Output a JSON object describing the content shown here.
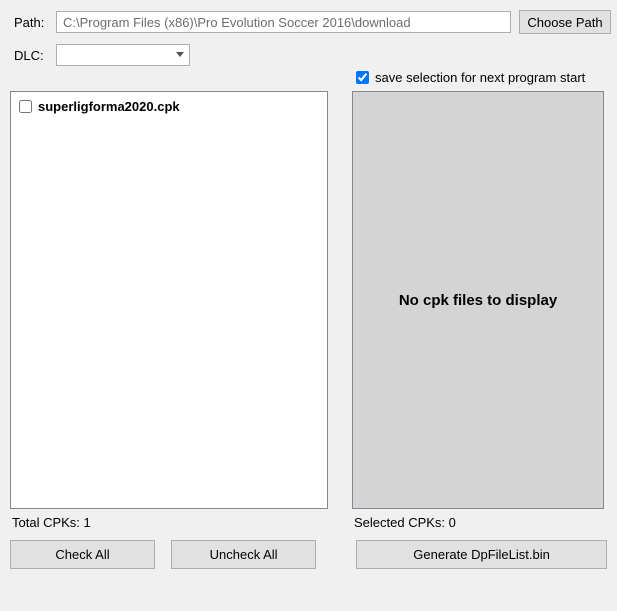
{
  "labels": {
    "path": "Path:",
    "dlc": "DLC:"
  },
  "path": {
    "value": "C:\\Program Files (x86)\\Pro Evolution Soccer 2016\\download"
  },
  "buttons": {
    "choose_path": "Choose Path",
    "check_all": "Check All",
    "uncheck_all": "Uncheck All",
    "generate": "Generate DpFileList.bin"
  },
  "save_checkbox": {
    "label": "save selection for next program start",
    "checked": true
  },
  "cpk_list": {
    "items": [
      {
        "name": "superligforma2020.cpk",
        "checked": false
      }
    ]
  },
  "display": {
    "empty_text": "No cpk files to display"
  },
  "counts": {
    "total_label": "Total CPKs: ",
    "total_value": "1",
    "selected_label": "Selected CPKs: ",
    "selected_value": "0"
  },
  "dlc": {
    "selected": ""
  }
}
